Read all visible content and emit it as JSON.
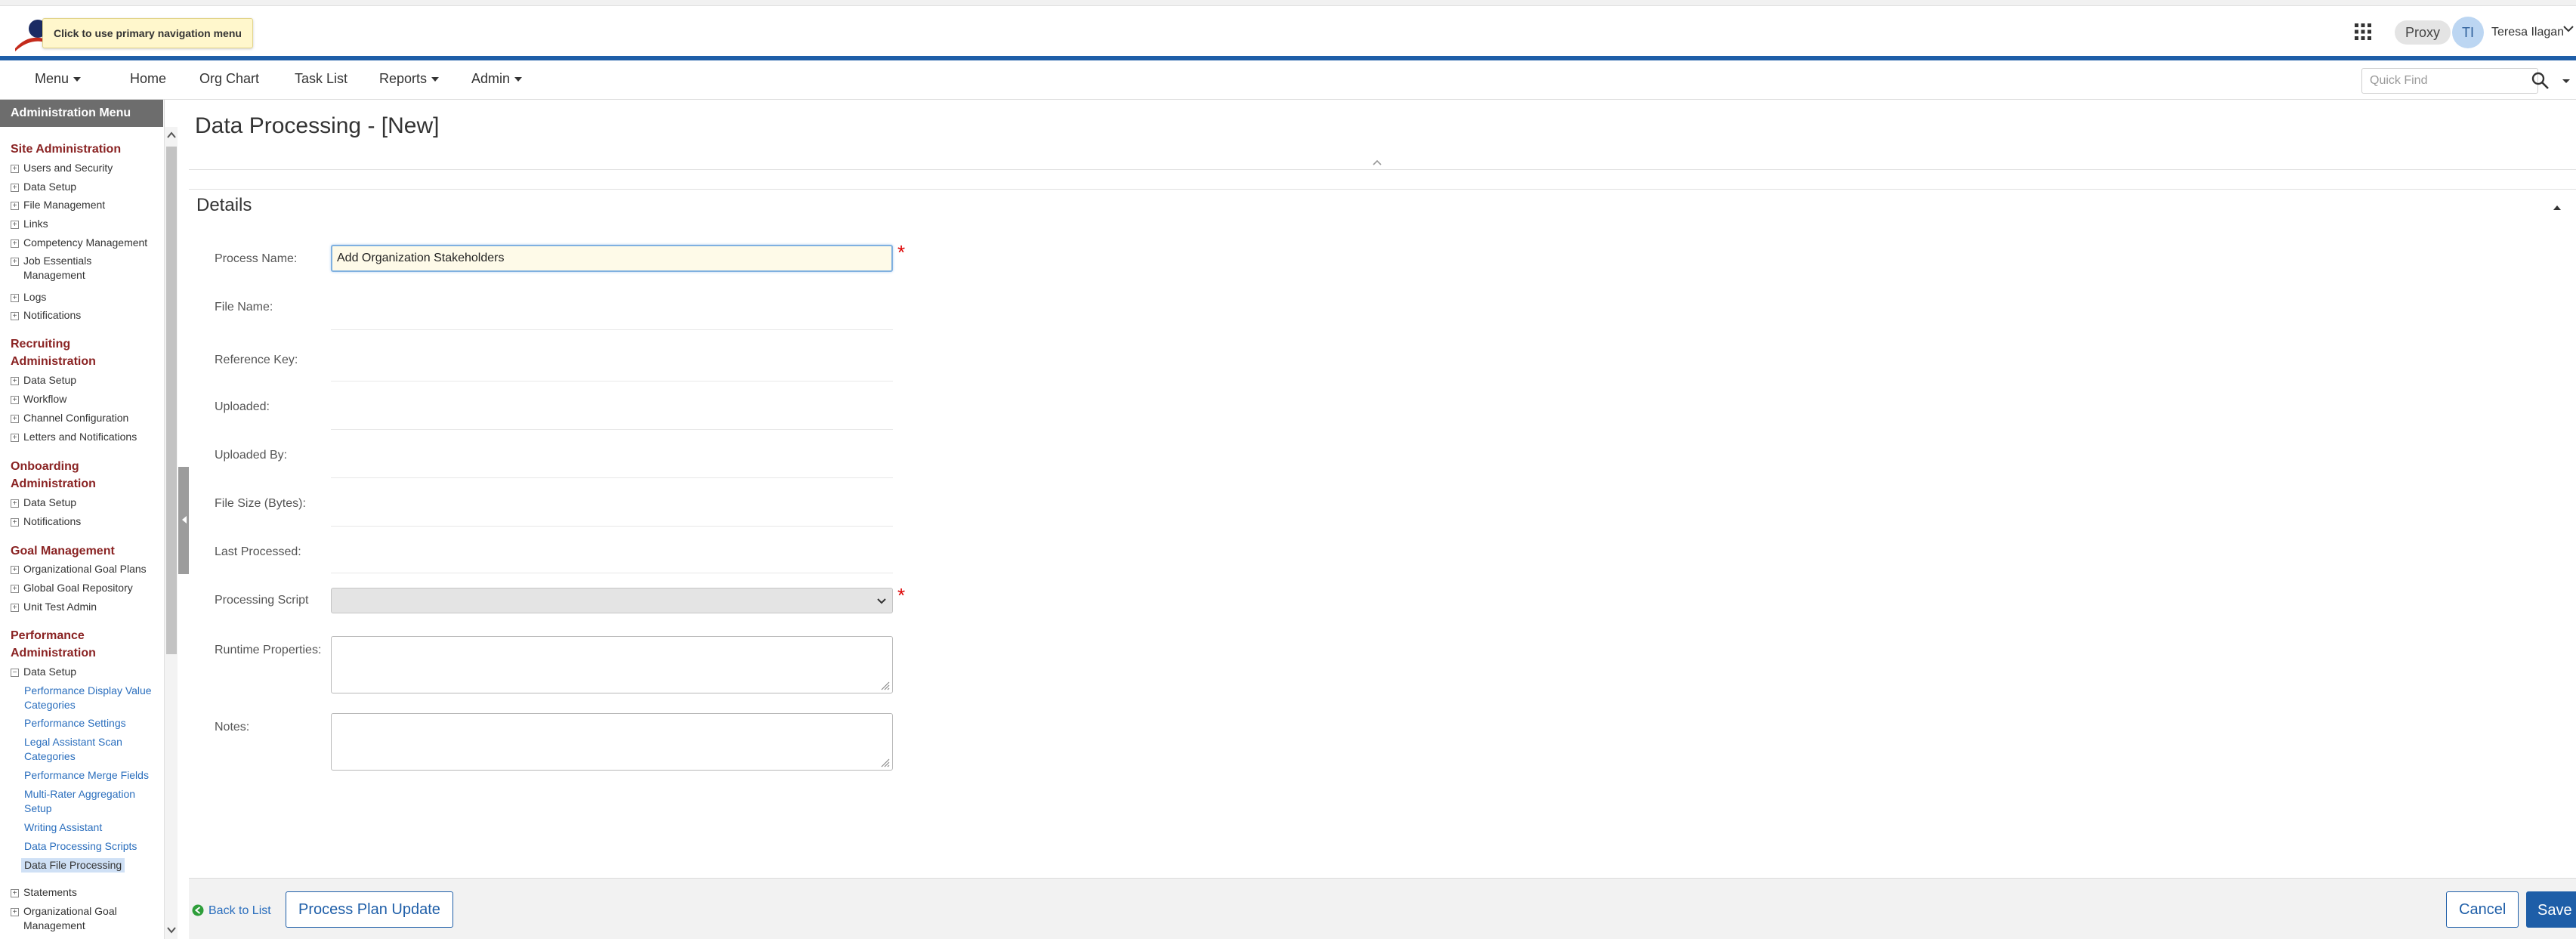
{
  "header": {
    "tooltip": "Click to use primary navigation menu",
    "proxy_label": "Proxy",
    "avatar_initials": "TI",
    "user_name": "Teresa Ilagan"
  },
  "nav": {
    "menu": "Menu",
    "home": "Home",
    "org_chart": "Org Chart",
    "task_list": "Task List",
    "reports": "Reports",
    "admin": "Admin",
    "quick_find_placeholder": "Quick Find"
  },
  "sidebar": {
    "title": "Administration Menu",
    "site_admin": {
      "heading": "Site Administration",
      "items": [
        "Users and Security",
        "Data Setup",
        "File Management",
        "Links",
        "Competency Management",
        "Job Essentials Management",
        "Logs",
        "Notifications"
      ]
    },
    "recruiting": {
      "heading": "Recruiting Administration",
      "items": [
        "Data Setup",
        "Workflow",
        "Channel Configuration",
        "Letters and Notifications"
      ]
    },
    "onboarding": {
      "heading": "Onboarding Administration",
      "items": [
        "Data Setup",
        "Notifications"
      ]
    },
    "goal": {
      "heading": "Goal Management",
      "items": [
        "Organizational Goal Plans",
        "Global Goal Repository",
        "Unit Test Admin"
      ]
    },
    "performance": {
      "heading": "Performance Administration",
      "data_setup": "Data Setup",
      "links": [
        "Performance Display Value Categories",
        "Performance Settings",
        "Legal Assistant Scan Categories",
        "Performance Merge Fields",
        "Multi-Rater Aggregation Setup",
        "Writing Assistant",
        "Data Processing Scripts",
        "Data File Processing"
      ],
      "items_after": [
        "Statements",
        "Organizational Goal Management"
      ]
    }
  },
  "page": {
    "title": "Data Processing - [New]",
    "section": "Details"
  },
  "form": {
    "process_name_label": "Process Name:",
    "process_name_value": "Add Organization Stakeholders",
    "file_name_label": "File Name:",
    "reference_key_label": "Reference Key:",
    "uploaded_label": "Uploaded:",
    "uploaded_by_label": "Uploaded By:",
    "file_size_label": "File Size (Bytes):",
    "last_processed_label": "Last Processed:",
    "processing_script_label": "Processing Script",
    "runtime_properties_label": "Runtime Properties:",
    "notes_label": "Notes:",
    "required_mark": "*"
  },
  "footer": {
    "back_to_list": "Back to List",
    "process_plan_update": "Process Plan Update",
    "cancel": "Cancel",
    "save": "Save"
  },
  "colors": {
    "brand_blue": "#1e5ea8",
    "sidebar_heading": "#8a2323",
    "link_blue": "#2a6ebd",
    "required_red": "#dd0000"
  }
}
